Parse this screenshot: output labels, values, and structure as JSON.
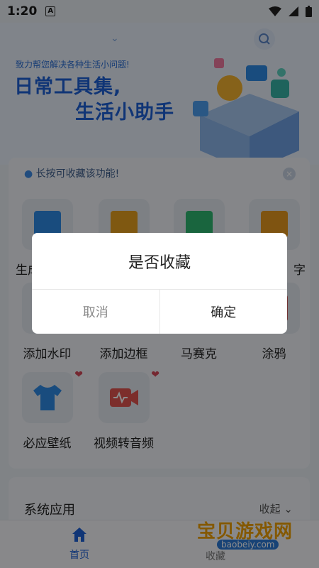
{
  "status_bar": {
    "time": "1:20",
    "app_indicator": "A"
  },
  "hero": {
    "tagline": "致力帮您解决各种生活小问题!",
    "title_line1": "日常工具集,",
    "title_line2": "生活小助手"
  },
  "tools_card": {
    "tip": "长按可收藏该功能!",
    "tools": [
      {
        "label": "生成",
        "icon": "qr-code-icon",
        "color": "#2f8be6"
      },
      {
        "label": "",
        "icon": "scan-frame-icon",
        "color": "#e8a020"
      },
      {
        "label": "",
        "icon": "crop-icon",
        "color": "#2eb872"
      },
      {
        "label": "字",
        "icon": "text-icon",
        "color": "#e89a20"
      },
      {
        "label": "添加水印",
        "icon": "watermark-icon",
        "color": "#5a7fc0"
      },
      {
        "label": "添加边框",
        "icon": "border-icon",
        "color": "#e0a040"
      },
      {
        "label": "马赛克",
        "icon": "mosaic-icon",
        "color": "#d8a050"
      },
      {
        "label": "涂鸦",
        "icon": "doodle-icon",
        "color": "#d06060"
      },
      {
        "label": "必应壁纸",
        "icon": "tshirt-icon",
        "color": "#2f8be6",
        "favorited": true
      },
      {
        "label": "视频转音频",
        "icon": "video-audio-icon",
        "color": "#e2554f",
        "favorited": true
      }
    ]
  },
  "system_section": {
    "title": "系统应用",
    "collapse_label": "收起"
  },
  "bottom_nav": {
    "home_label": "首页",
    "second_label": "收藏"
  },
  "watermark": {
    "text": "宝贝游戏网",
    "url": "baobeiy.com"
  },
  "dialog": {
    "message": "是否收藏",
    "cancel_label": "取消",
    "confirm_label": "确定"
  },
  "colors": {
    "accent": "#1e62d8",
    "favorite": "#d64a5a"
  }
}
